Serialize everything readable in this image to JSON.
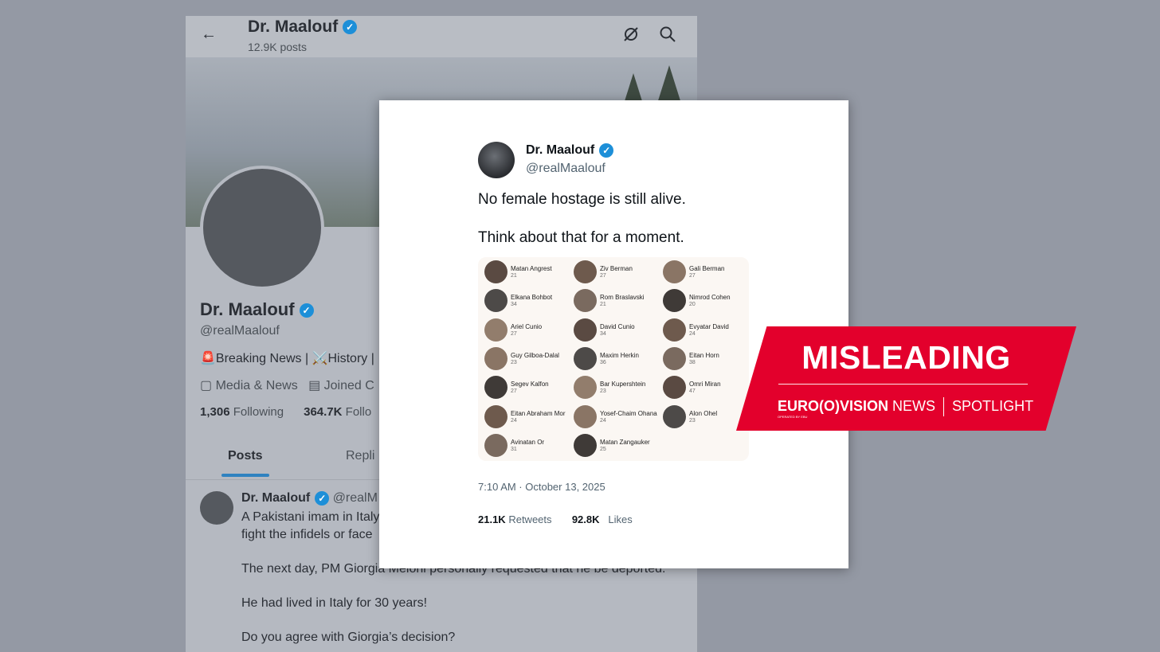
{
  "profile": {
    "header_name": "Dr. Maalouf",
    "post_count": "12.9K posts",
    "name": "Dr. Maalouf",
    "handle": "@realMaalouf",
    "bio": "🚨Breaking News | ⚔️History |",
    "meta_category": "Media & News",
    "meta_joined": "Joined C",
    "following_count": "1,306",
    "following_label": "Following",
    "followers_count": "364.7K",
    "followers_label": "Follo",
    "tabs": [
      "Posts",
      "Repli"
    ],
    "post": {
      "name": "Dr. Maalouf",
      "handle": "@realM",
      "lines": [
        "A Pakistani imam in Italy",
        "fight the infidels or face",
        "The next day, PM Giorgia Meloni personally requested that he be deported.",
        "He had lived in Italy for 30 years!",
        "Do you agree with Giorgia’s decision?"
      ]
    }
  },
  "tweet": {
    "name": "Dr. Maalouf",
    "handle": "@realMaalouf",
    "line1": "No female hostage is still alive.",
    "line2": "Think about that for a moment.",
    "people": [
      {
        "name": "Matan Angrest",
        "age": "21"
      },
      {
        "name": "Ziv Berman",
        "age": "27"
      },
      {
        "name": "Gali Berman",
        "age": "27"
      },
      {
        "name": "Elkana Bohbot",
        "age": "34"
      },
      {
        "name": "Rom Braslavski",
        "age": "21"
      },
      {
        "name": "Nimrod Cohen",
        "age": "20"
      },
      {
        "name": "Ariel Cunio",
        "age": "27"
      },
      {
        "name": "David Cunio",
        "age": "34"
      },
      {
        "name": "Evyatar David",
        "age": "24"
      },
      {
        "name": "Guy Gilboa-Dalal",
        "age": "23"
      },
      {
        "name": "Maxim Herkin",
        "age": "36"
      },
      {
        "name": "Eitan Horn",
        "age": "38"
      },
      {
        "name": "Segev Kalfon",
        "age": "27"
      },
      {
        "name": "Bar Kupershtein",
        "age": "23"
      },
      {
        "name": "Omri Miran",
        "age": "47"
      },
      {
        "name": "Eitan Abraham Mor",
        "age": "24"
      },
      {
        "name": "Yosef-Chaim Ohana",
        "age": "24"
      },
      {
        "name": "Alon Ohel",
        "age": "23"
      },
      {
        "name": "Avinatan Or",
        "age": "31"
      },
      {
        "name": "Matan Zangauker",
        "age": "25"
      }
    ],
    "timestamp": "7:10 AM · October 13, 2025",
    "retweets_count": "21.1K",
    "retweets_label": "Retweets",
    "likes_count": "92.8K",
    "likes_label": "Likes"
  },
  "label": {
    "title": "MISLEADING",
    "brand_bold": "EURO",
    "brand_mid": "VISION",
    "brand_news": " NEWS",
    "brand_spotlight": "SPOTLIGHT",
    "brand_sub": "OPERATED BY EBU",
    "color": "#e3002c"
  },
  "icons": [
    "back-arrow-icon",
    "verified-badge-icon",
    "no-notifications-icon",
    "search-icon",
    "briefcase-icon",
    "calendar-icon"
  ]
}
